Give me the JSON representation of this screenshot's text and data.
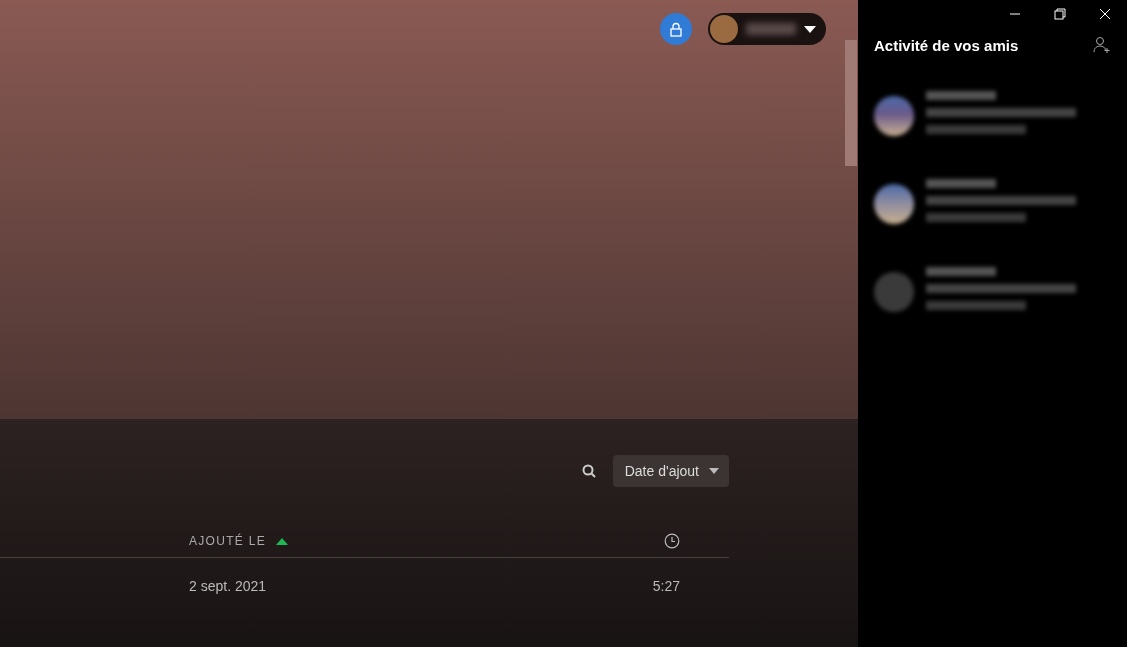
{
  "header": {
    "private_session": true
  },
  "toolbar": {
    "sort_button": {
      "label": "Date d'ajout"
    }
  },
  "table": {
    "columns": [
      {
        "label": "AJOUTÉ LE",
        "sorted_ascending": true
      },
      {
        "kind": "duration"
      }
    ],
    "rows": [
      {
        "added": "2 sept. 2021",
        "duration": "5:27"
      }
    ]
  },
  "friend_activity": {
    "title": "Activité de vos amis",
    "friends": [
      {
        "kind": "photo",
        "color": "#6a5a8a"
      },
      {
        "kind": "photo",
        "color": "#8a8aa0"
      },
      {
        "kind": "plain",
        "color": "#3a3a3a"
      }
    ]
  }
}
